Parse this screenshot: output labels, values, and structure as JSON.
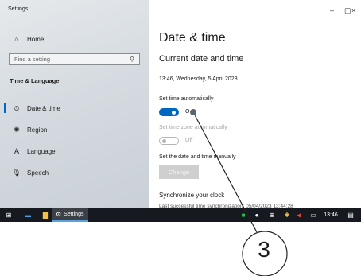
{
  "window": {
    "title": "Settings",
    "controls": {
      "minimize": "–",
      "maximize": "▢",
      "close": "×"
    }
  },
  "sidebar": {
    "home": {
      "label": "Home",
      "icon": "home-icon",
      "glyph": "⌂"
    },
    "search_placeholder": "Find a setting",
    "search_glyph": "⚲",
    "section_heading": "Time & Language",
    "items": [
      {
        "label": "Date & time",
        "icon": "calendar-clock-icon",
        "glyph": "⏲",
        "selected": true
      },
      {
        "label": "Region",
        "icon": "globe-icon",
        "glyph": "✺",
        "selected": false
      },
      {
        "label": "Language",
        "icon": "language-icon",
        "glyph": "A",
        "selected": false
      },
      {
        "label": "Speech",
        "icon": "microphone-icon",
        "glyph": "🎙",
        "selected": false
      }
    ]
  },
  "main": {
    "title": "Date & time",
    "subtitle": "Current date and time",
    "datetime": "13:46, Wednesday, 5 April 2023",
    "set_time_auto": {
      "label": "Set time automatically",
      "state": "On",
      "on": true
    },
    "set_zone_auto": {
      "label": "Set time zone automatically",
      "state": "Off",
      "on": false
    },
    "manual": {
      "label": "Set the date and time manually",
      "button": "Change"
    },
    "sync": {
      "heading": "Synchronize your clock",
      "text": "Last successful time synchronization: 05/04/2023 13:44:28"
    }
  },
  "taskbar": {
    "settings_label": "Settings",
    "clock": "13:46",
    "accent": "#0067c0"
  },
  "callout": {
    "number": "3"
  }
}
